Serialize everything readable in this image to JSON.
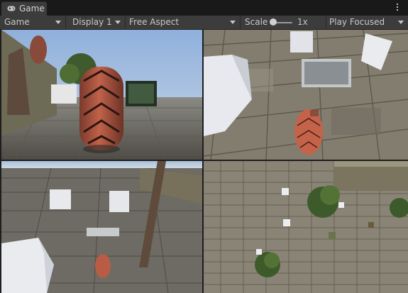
{
  "window": {
    "tab_title": "Game",
    "tab_icon": "gamepad-icon",
    "menu_icon": "kebab-menu-icon"
  },
  "toolbar": {
    "view_mode": "Game",
    "display": "Display 1",
    "aspect": "Free Aspect",
    "scale_label": "Scale",
    "scale_value": "1x",
    "scale_slider_level": 0.0,
    "play_mode": "Play Focused"
  },
  "viewports": [
    {
      "name": "camera-top-left"
    },
    {
      "name": "camera-top-right"
    },
    {
      "name": "camera-bottom-left"
    },
    {
      "name": "camera-bottom-right"
    }
  ],
  "colors": {
    "editor_bg": "#191919",
    "toolbar_bg": "#3c3c3c",
    "sky": "#8fb3df",
    "floor": "#6e6a5e"
  }
}
